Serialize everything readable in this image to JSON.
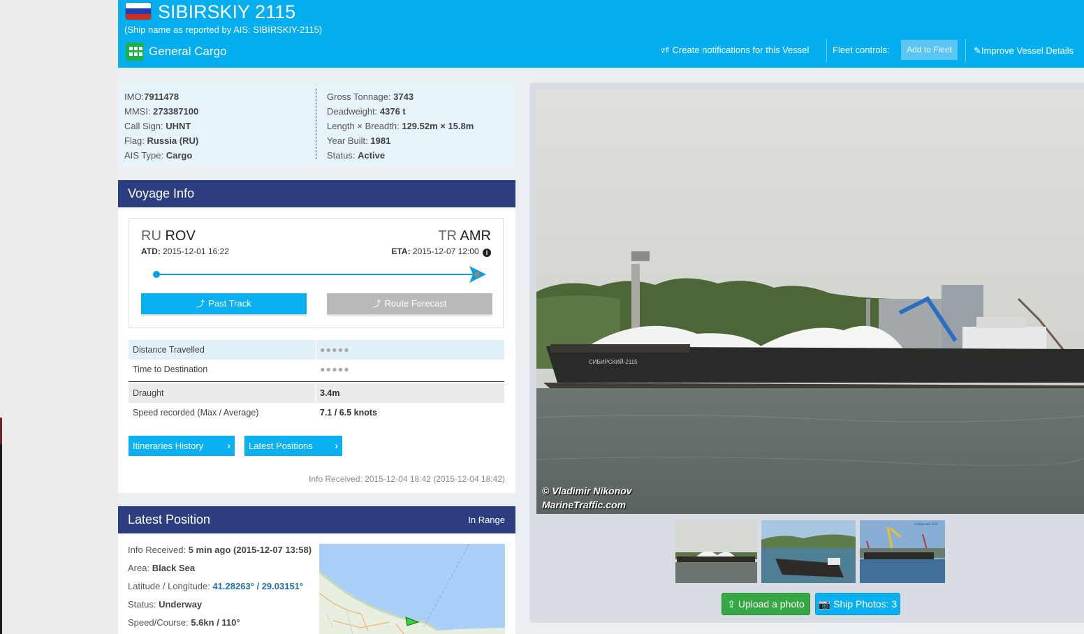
{
  "vessel": {
    "name": "SIBIRSKIY 2115",
    "ais_name_note": "(Ship name as reported by AIS: SIBIRSKIY-2115)",
    "type": "General Cargo",
    "flag_icon": "russia-flag-icon"
  },
  "header": {
    "notifications_label": "Create notifications for this Vessel",
    "fleet_controls_label": "Fleet controls:",
    "add_to_fleet_label": "Add to Fleet",
    "improve_label": "Improve Vessel Details"
  },
  "details": {
    "left": [
      {
        "key": "IMO:",
        "value": "7911478"
      },
      {
        "key": "MMSI: ",
        "value": "273387100"
      },
      {
        "key": "Call Sign: ",
        "value": "UHNT"
      },
      {
        "key": "Flag: ",
        "value": "Russia (RU)"
      },
      {
        "key": "AIS Type: ",
        "value": "Cargo"
      }
    ],
    "right": [
      {
        "key": "Gross Tonnage: ",
        "value": "3743"
      },
      {
        "key": "Deadweight: ",
        "value": "4376 t"
      },
      {
        "key": "Length × Breadth: ",
        "value": "129.52m × 15.8m"
      },
      {
        "key": "Year Built: ",
        "value": "1981"
      },
      {
        "key": "Status: ",
        "value": "Active"
      }
    ]
  },
  "voyage": {
    "title": "Voyage Info",
    "from_country": "RU",
    "from_port": "ROV",
    "to_country": "TR",
    "to_port": "AMR",
    "atd_label": "ATD:",
    "atd_value": "2015-12-01 16:22",
    "eta_label": "ETA:",
    "eta_value": "2015-12-07 12:00",
    "past_track_label": "Past Track",
    "route_forecast_label": "Route Forecast",
    "stats": [
      {
        "key": "Distance Travelled",
        "value": "●●●●●"
      },
      {
        "key": "Time to Destination",
        "value": "●●●●●"
      },
      {
        "key": "Draught",
        "value": "3.4m"
      },
      {
        "key": "Speed recorded (Max / Average)",
        "value": "7.1 / 6.5 knots"
      }
    ],
    "itineraries_label": "Itineraries History",
    "latest_positions_label": "Latest Positions",
    "info_received": "Info Received: 2015-12-04 18:42 (2015-12-04 18:42)"
  },
  "latest_position": {
    "title": "Latest Position",
    "range_tag": "In Range",
    "info_received_key": "Info Received: ",
    "info_received_value": "5 min ago (2015-12-07 13:58)",
    "area_key": "Area: ",
    "area_value": "Black Sea",
    "latlon_key": "Latitude / Longitude: ",
    "latlon_value": "41.28263° / 29.03151°",
    "status_key": "Status: ",
    "status_value": "Underway",
    "speed_key": "Speed/Course: ",
    "speed_value": "5.6kn / 110°"
  },
  "photos": {
    "credit_line1": "© Vladimir Nikonov",
    "credit_line2": "MarineTraffic.com",
    "upload_label": "Upload a photo",
    "ship_photos_label": "Ship Photos: 3",
    "ship_text": "СИБИРСКИЙ-2115",
    "thumb3_caption": "Сибирский 2115"
  },
  "colors": {
    "header_bg": "#04aeef",
    "panel_head": "#2d3e80",
    "accent": "#0ab0f0",
    "green": "#35a845"
  }
}
